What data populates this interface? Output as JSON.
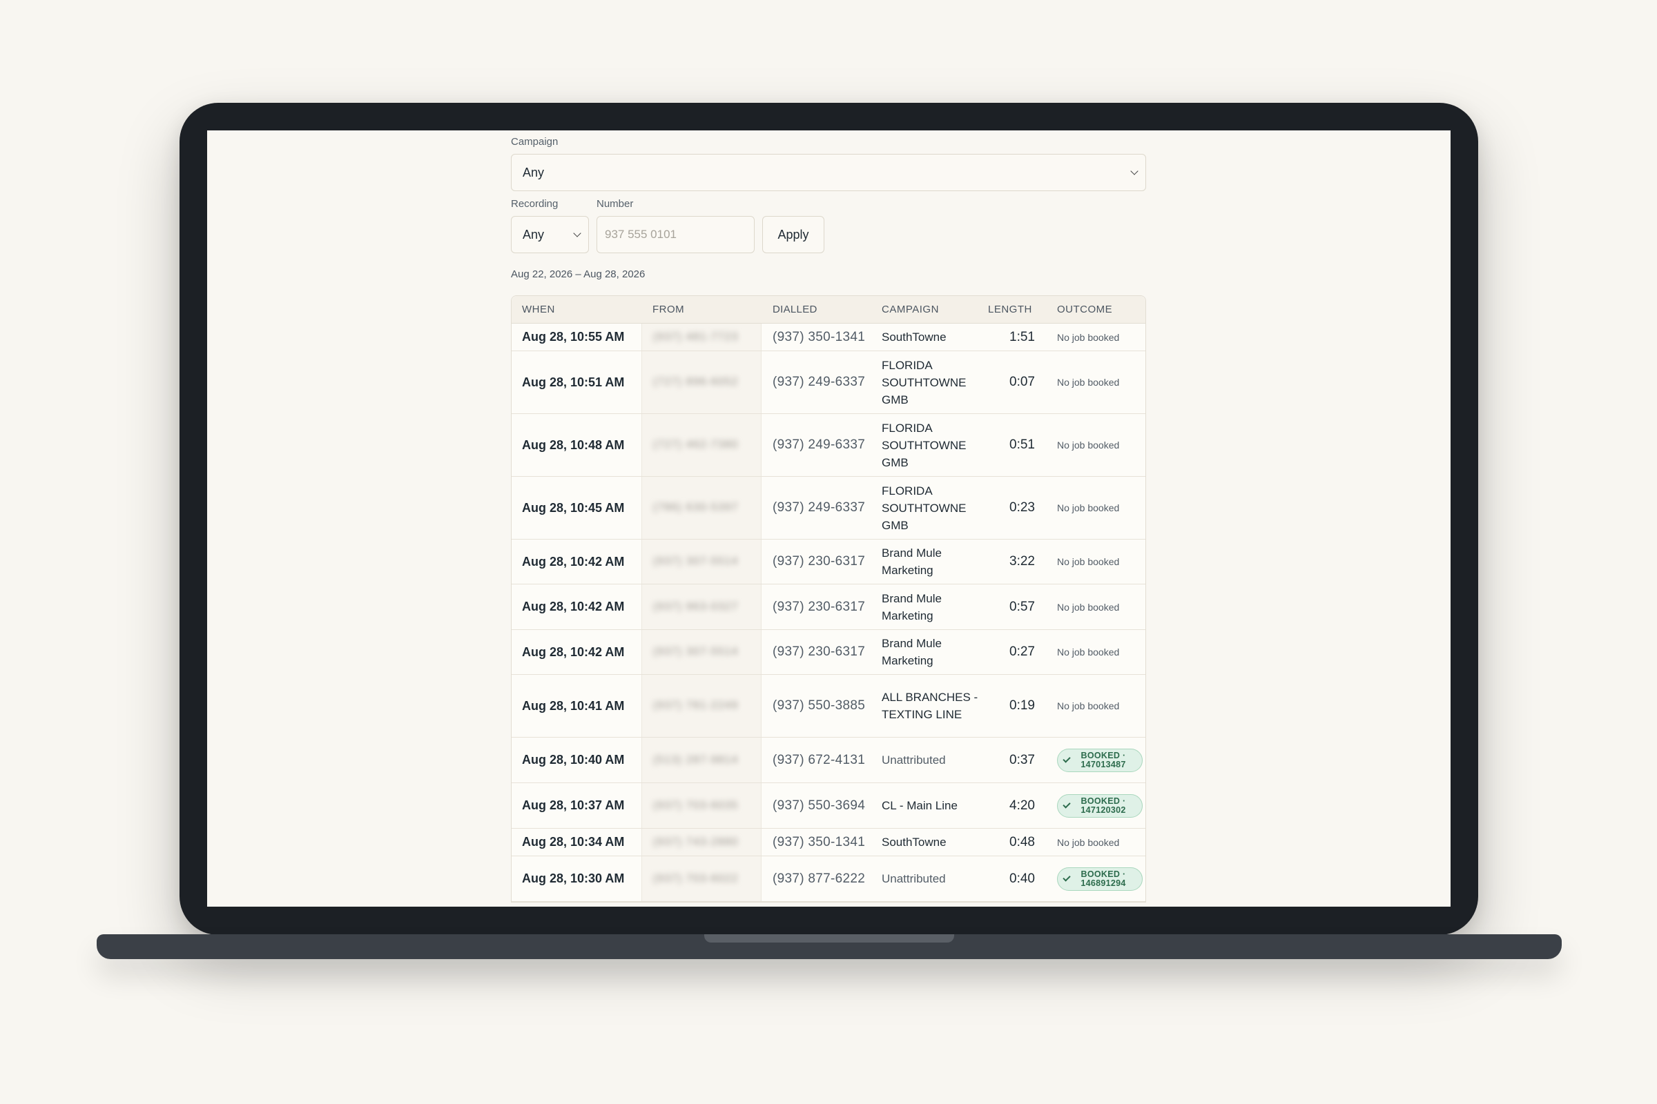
{
  "filters": {
    "campaign_label": "Campaign",
    "campaign_value": "Any",
    "recording_label": "Recording",
    "recording_value": "Any",
    "number_label": "Number",
    "number_placeholder": "937 555 0101",
    "apply_label": "Apply"
  },
  "date_range": "Aug 22, 2026 – Aug 28, 2026",
  "table": {
    "headers": [
      "WHEN",
      "FROM",
      "DIALLED",
      "CAMPAIGN",
      "LENGTH",
      "OUTCOME"
    ],
    "rows": [
      {
        "when": "Aug 28, 10:55 AM",
        "from": "(937) 481-7723",
        "dialled": "(937) 350-1341",
        "campaign": "SouthTowne",
        "length": "1:51",
        "outcome": "No job booked",
        "booked": false
      },
      {
        "when": "Aug 28, 10:51 AM",
        "from": "(727) 896-6052",
        "dialled": "(937) 249-6337",
        "campaign": "FLORIDA SOUTHTOWNE GMB",
        "length": "0:07",
        "outcome": "No job booked",
        "booked": false
      },
      {
        "when": "Aug 28, 10:48 AM",
        "from": "(727) 462-7380",
        "dialled": "(937) 249-6337",
        "campaign": "FLORIDA SOUTHTOWNE GMB",
        "length": "0:51",
        "outcome": "No job booked",
        "booked": false
      },
      {
        "when": "Aug 28, 10:45 AM",
        "from": "(786) 630-5397",
        "dialled": "(937) 249-6337",
        "campaign": "FLORIDA SOUTHTOWNE GMB",
        "length": "0:23",
        "outcome": "No job booked",
        "booked": false
      },
      {
        "when": "Aug 28, 10:42 AM",
        "from": "(937) 307-5514",
        "dialled": "(937) 230-6317",
        "campaign": "Brand Mule Marketing",
        "length": "3:22",
        "outcome": "No job booked",
        "booked": false
      },
      {
        "when": "Aug 28, 10:42 AM",
        "from": "(937) 963-0327",
        "dialled": "(937) 230-6317",
        "campaign": "Brand Mule Marketing",
        "length": "0:57",
        "outcome": "No job booked",
        "booked": false
      },
      {
        "when": "Aug 28, 10:42 AM",
        "from": "(937) 307-5514",
        "dialled": "(937) 230-6317",
        "campaign": "Brand Mule Marketing",
        "length": "0:27",
        "outcome": "No job booked",
        "booked": false
      },
      {
        "when": "Aug 28, 10:41 AM",
        "from": "(937) 781-2249",
        "dialled": "(937) 550-3885",
        "campaign": "ALL BRANCHES - TEXTING LINE",
        "length": "0:19",
        "outcome": "No job booked",
        "booked": false
      },
      {
        "when": "Aug 28, 10:40 AM",
        "from": "(513) 287-9814",
        "dialled": "(937) 672-4131",
        "campaign": "Unattributed",
        "length": "0:37",
        "outcome": "BOOKED · 147013487",
        "booked": true
      },
      {
        "when": "Aug 28, 10:37 AM",
        "from": "(937) 703-6035",
        "dialled": "(937) 550-3694",
        "campaign": "CL - Main Line",
        "length": "4:20",
        "outcome": "BOOKED · 147120302",
        "booked": true
      },
      {
        "when": "Aug 28, 10:34 AM",
        "from": "(937) 743-2880",
        "dialled": "(937) 350-1341",
        "campaign": "SouthTowne",
        "length": "0:48",
        "outcome": "No job booked",
        "booked": false
      },
      {
        "when": "Aug 28, 10:30 AM",
        "from": "(937) 703-6022",
        "dialled": "(937) 877-6222",
        "campaign": "Unattributed",
        "length": "0:40",
        "outcome": "BOOKED · 146891294",
        "booked": true
      }
    ]
  },
  "colors": {
    "page_bg": "#f8f6f1",
    "frame": "#1c2025",
    "badge_bg": "#dff1e7",
    "badge_text": "#2c6b4c"
  }
}
